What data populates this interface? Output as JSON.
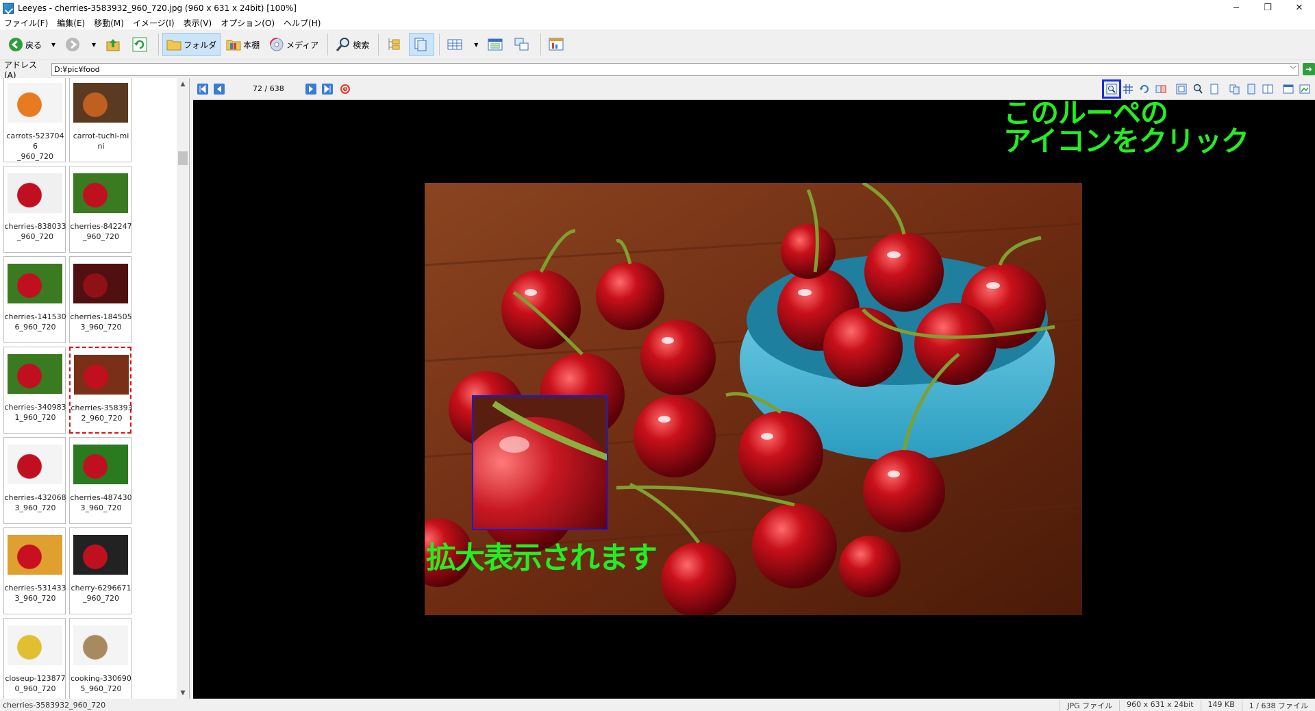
{
  "window": {
    "title": "Leeyes - cherries-3583932_960_720.jpg (960 x 631 x 24bit) [100%]",
    "controls": [
      "─",
      "❐",
      "✕"
    ]
  },
  "menu": [
    "ファイル(F)",
    "編集(E)",
    "移動(M)",
    "イメージ(I)",
    "表示(V)",
    "オプション(O)",
    "ヘルプ(H)"
  ],
  "toolbar": {
    "back_label": "戻る",
    "folder_label": "フォルダ",
    "bookshelf_label": "本棚",
    "media_label": "メディア",
    "search_label": "検索"
  },
  "address": {
    "label": "アドレス(A)",
    "value": "D:¥pic¥food"
  },
  "thumbnails": [
    {
      "name": "carrots-5237046_960_720",
      "line1": "carrots-5237046",
      "line2": "_960_720"
    },
    {
      "name": "carrot-tuchi-mini",
      "line1": "carrot-tuchi-mi",
      "line2": "ni"
    },
    {
      "name": "cherries-838033_960_720",
      "line1": "cherries-838033",
      "line2": "_960_720"
    },
    {
      "name": "cherries-842247_960_720",
      "line1": "cherries-842247",
      "line2": "_960_720"
    },
    {
      "name": "cherries-1415306_960_720",
      "line1": "cherries-141530",
      "line2": "6_960_720"
    },
    {
      "name": "cherries-1845053_960_720",
      "line1": "cherries-184505",
      "line2": "3_960_720"
    },
    {
      "name": "cherries-3409831_960_720",
      "line1": "cherries-340983",
      "line2": "1_960_720"
    },
    {
      "name": "cherries-3583932_960_720",
      "line1": "cherries-358393",
      "line2": "2_960_720",
      "selected": true
    },
    {
      "name": "cherries-4320683_960_720",
      "line1": "cherries-432068",
      "line2": "3_960_720"
    },
    {
      "name": "cherries-4874303_960_720",
      "line1": "cherries-487430",
      "line2": "3_960_720"
    },
    {
      "name": "cherries-5314333_960_720",
      "line1": "cherries-531433",
      "line2": "3_960_720"
    },
    {
      "name": "cherry-6296671_960_720",
      "line1": "cherry-6296671",
      "line2": "_960_720"
    },
    {
      "name": "closeup-1238770_960_720",
      "line1": "closeup-123877",
      "line2": "0_960_720"
    },
    {
      "name": "cooking-3306905_960_720",
      "line1": "cooking-330690",
      "line2": "5_960_720"
    }
  ],
  "viewer": {
    "counter": "72 / 638"
  },
  "annotations": {
    "loupe_line1": "このルーペの",
    "loupe_line2": "アイコンをクリック",
    "magnified": "拡大表示されます"
  },
  "status": {
    "filename": "cherries-3583932_960_720",
    "filetype": "JPG ファイル",
    "dimensions": "960 x 631 x 24bit",
    "size": "149 KB",
    "position": "1 / 638 ファイル"
  },
  "colors": {
    "annotation": "#22ee22",
    "highlight_box": "#1a2de0",
    "selection": "#dd1111"
  }
}
